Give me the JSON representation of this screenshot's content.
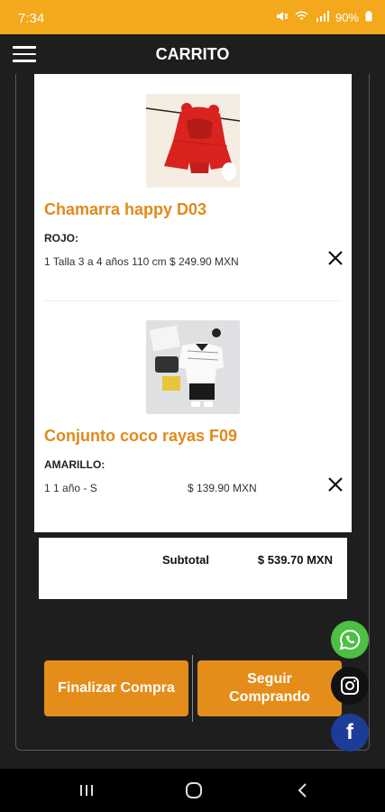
{
  "status": {
    "time": "7:34",
    "battery": "90%"
  },
  "header": {
    "title": "CARRITO"
  },
  "cart": {
    "items": [
      {
        "name": "Chamarra happy D03",
        "color": "ROJO:",
        "description": "1 Talla 3 a 4 años 110 cm $ 249.90 MXN",
        "price": ""
      },
      {
        "name": "Conjunto coco rayas F09",
        "color": "AMARILLO:",
        "description": "1 1 año - S",
        "price": "$ 139.90 MXN"
      }
    ],
    "subtotal_label": "Subtotal",
    "subtotal_value": "$ 539.70 MXN"
  },
  "actions": {
    "finalizar": "Finalizar Compra",
    "seguir": "Seguir Comprando"
  },
  "social": {
    "facebook_letter": "f"
  },
  "colors": {
    "accent": "#e58d1a",
    "status_bar": "#f4a81c",
    "whatsapp": "#4dbf43",
    "facebook": "#1c3d97"
  }
}
